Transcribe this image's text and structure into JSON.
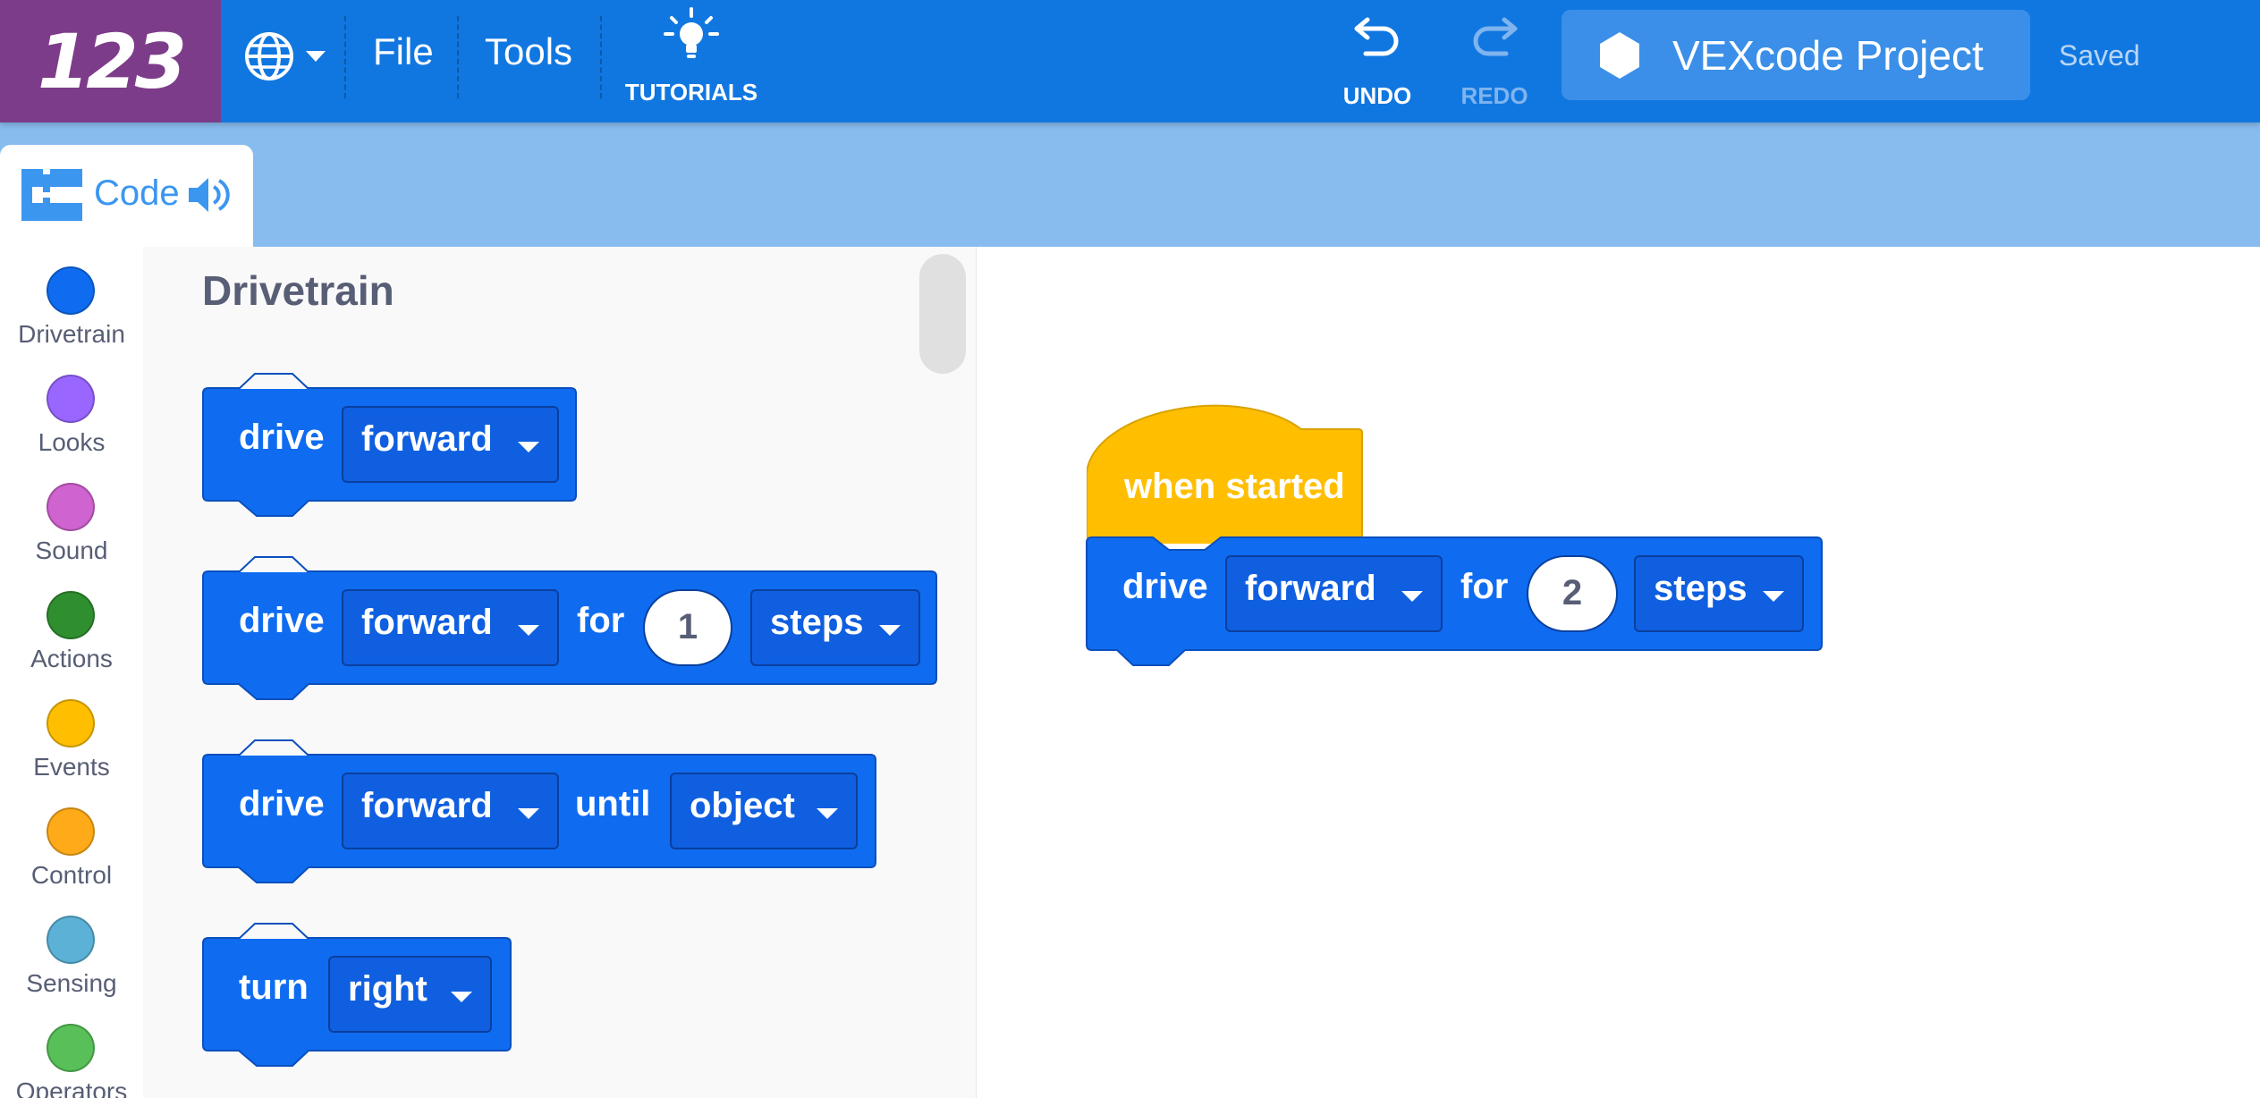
{
  "app": {
    "logo_text": "123",
    "menu": {
      "language_icon": "globe-icon",
      "file_label": "File",
      "tools_label": "Tools",
      "tutorials_label": "TUTORIALS",
      "tutorials_icon": "lightbulb-icon"
    },
    "history": {
      "undo_label": "UNDO",
      "redo_label": "REDO"
    },
    "project": {
      "name": "VEXcode Project",
      "icon": "hexagon-icon",
      "status": "Saved"
    },
    "colors": {
      "topbar": "#1177e0",
      "logo_bg": "#7d3c8a",
      "tabstrip": "#88bcef",
      "block_blue": "#0f6cf0",
      "block_yellow": "#ffbf00"
    }
  },
  "tabs": {
    "code_label": "Code",
    "code_icon": "code-blocks-icon",
    "sound_icon": "speaker-icon"
  },
  "categories": [
    {
      "label": "Drivetrain",
      "color": "#0f6cf0"
    },
    {
      "label": "Looks",
      "color": "#9966ff"
    },
    {
      "label": "Sound",
      "color": "#cf63cf"
    },
    {
      "label": "Actions",
      "color": "#2f8f2f"
    },
    {
      "label": "Events",
      "color": "#ffbf00"
    },
    {
      "label": "Control",
      "color": "#ffab19"
    },
    {
      "label": "Sensing",
      "color": "#5cb1d6"
    },
    {
      "label": "Operators",
      "color": "#59c059"
    }
  ],
  "flyout": {
    "title": "Drivetrain",
    "blocks": [
      {
        "keyword": "drive",
        "direction": "forward"
      },
      {
        "keyword": "drive",
        "direction": "forward",
        "for": "for",
        "amount": "1",
        "unit": "steps"
      },
      {
        "keyword": "drive",
        "direction": "forward",
        "until": "until",
        "target": "object"
      },
      {
        "keyword": "turn",
        "direction": "right"
      }
    ]
  },
  "workspace": {
    "hat_label": "when started",
    "block": {
      "keyword": "drive",
      "direction": "forward",
      "for": "for",
      "amount": "2",
      "unit": "steps"
    }
  }
}
